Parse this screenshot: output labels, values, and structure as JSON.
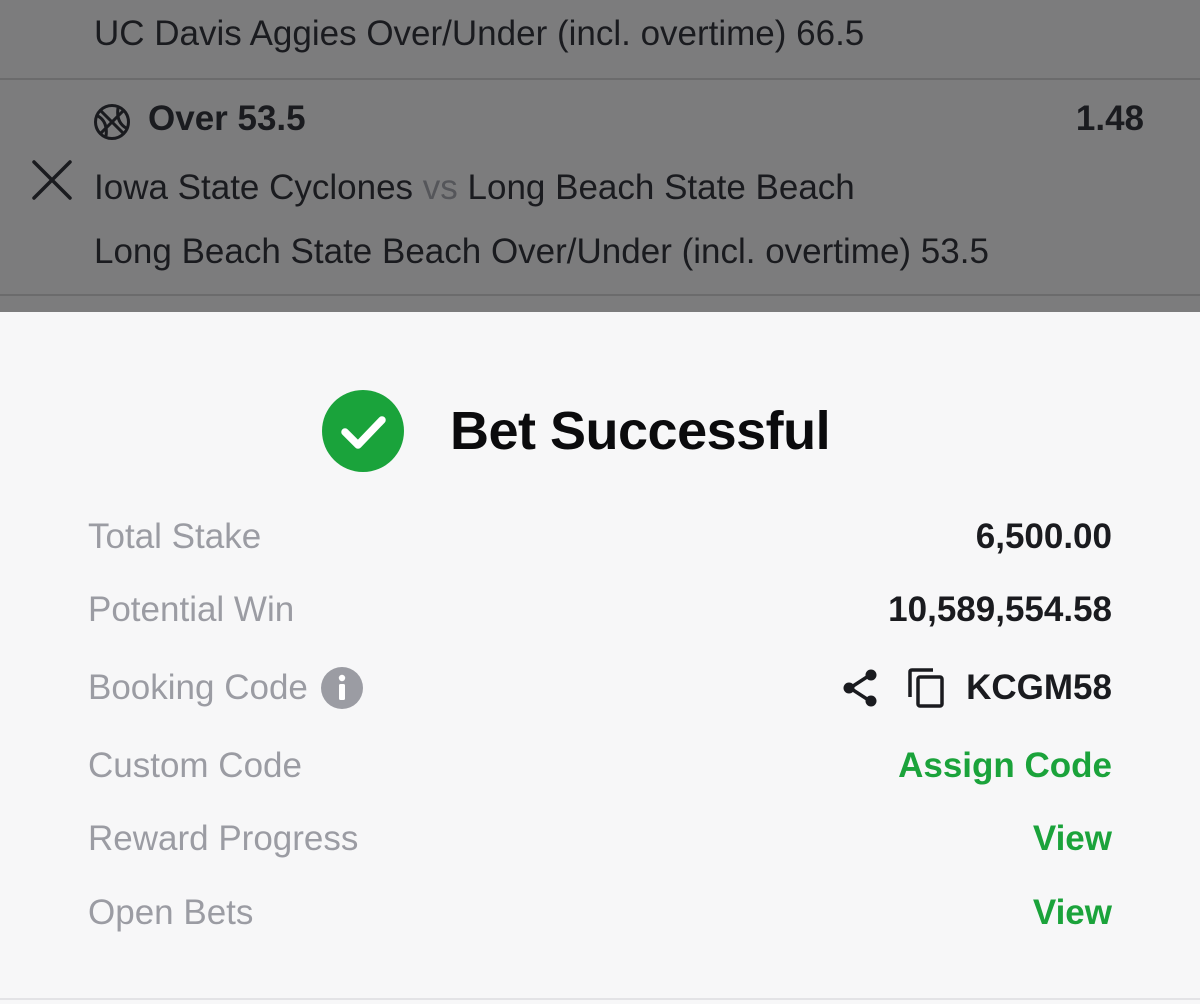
{
  "background_slip": {
    "previous_market": "UC Davis Aggies Over/Under (incl. overtime) 66.5",
    "selection": {
      "sport_icon": "basketball-icon",
      "label": "Over 53.5",
      "odds": "1.48",
      "home_team": "Iowa State Cyclones",
      "vs": "vs",
      "away_team": "Long Beach State Beach",
      "market": "Long Beach State Beach Over/Under (incl. overtime) 53.5"
    },
    "close_icon": "close-icon"
  },
  "success": {
    "icon": "check-circle-icon",
    "title": "Bet Successful",
    "rows": {
      "total_stake": {
        "label": "Total Stake",
        "value": "6,500.00"
      },
      "potential_win": {
        "label": "Potential Win",
        "value": "10,589,554.58"
      },
      "booking_code": {
        "label": "Booking Code",
        "value": "KCGM58"
      },
      "custom_code": {
        "label": "Custom Code",
        "value": "Assign Code"
      },
      "reward_progress": {
        "label": "Reward Progress",
        "value": "View"
      },
      "open_bets": {
        "label": "Open Bets",
        "value": "View"
      }
    }
  },
  "colors": {
    "accent_green": "#1ba33b",
    "check_green": "#1aa33b",
    "overlay": "#7c7c7d",
    "label_gray": "#9b9ca3",
    "text_dark": "#1a1b1f"
  }
}
